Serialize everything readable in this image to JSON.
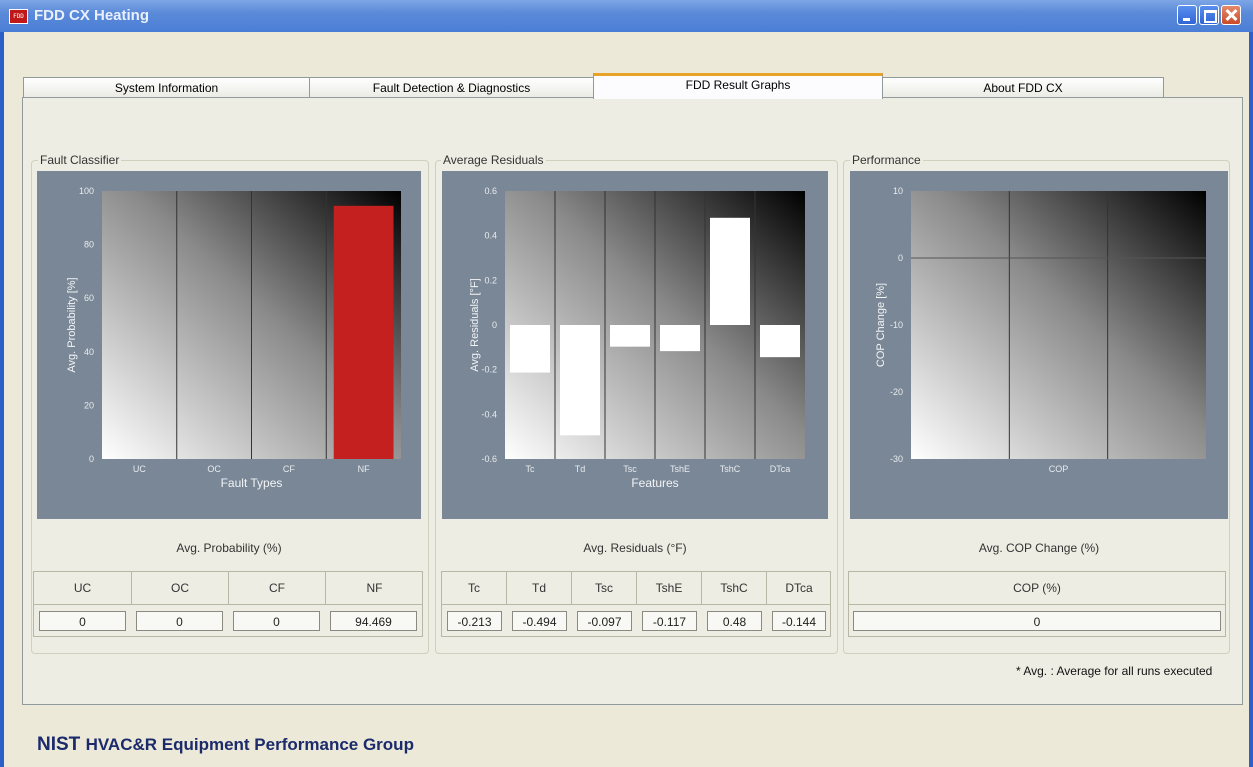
{
  "window": {
    "title": "FDD CX Heating",
    "icon": "FDD",
    "controls": [
      "minimize",
      "maximize",
      "close"
    ]
  },
  "tabs": [
    {
      "label": "System Information",
      "active": false
    },
    {
      "label": "Fault Detection & Diagnostics",
      "active": false
    },
    {
      "label": "FDD Result Graphs",
      "active": true
    },
    {
      "label": "About FDD CX",
      "active": false
    }
  ],
  "groups": {
    "fault_classifier": {
      "title": "Fault Classifier",
      "caption": "Avg. Probability (%)"
    },
    "average_residuals": {
      "title": "Average Residuals",
      "caption": "Avg. Residuals (°F)"
    },
    "performance": {
      "title": "Performance",
      "caption": "Avg. COP Change (%)"
    }
  },
  "chart_data": [
    {
      "type": "bar",
      "xlabel": "Fault Types",
      "ylabel": "Avg. Probability [%]",
      "categories": [
        "UC",
        "OC",
        "CF",
        "NF"
      ],
      "values": [
        0,
        0,
        0,
        94.469
      ],
      "ylim": [
        0,
        100
      ],
      "yticks": [
        "0",
        "20",
        "40",
        "60",
        "80",
        "100"
      ],
      "bar_color": "#c42020"
    },
    {
      "type": "bar",
      "xlabel": "Features",
      "ylabel": "Avg. Residuals [°F]",
      "categories": [
        "Tc",
        "Td",
        "Tsc",
        "TshE",
        "TshC",
        "DTca"
      ],
      "values": [
        -0.213,
        -0.494,
        -0.097,
        -0.117,
        0.48,
        -0.144
      ],
      "ylim": [
        -0.6,
        0.6
      ],
      "yticks": [
        "-0.6",
        "-0.4",
        "-0.2",
        "0",
        "0.2",
        "0.4",
        "0.6"
      ],
      "bar_color": "#ffffff"
    },
    {
      "type": "bar",
      "xlabel": "",
      "ylabel": "COP Change [%]",
      "categories": [
        "COP"
      ],
      "values": [
        0
      ],
      "ylim": [
        -30,
        10
      ],
      "yticks": [
        "-30",
        "-20",
        "-10",
        "0",
        "10"
      ],
      "bar_color": "#ffffff"
    }
  ],
  "tables": {
    "fault_classifier": {
      "headers": [
        "UC",
        "OC",
        "CF",
        "NF"
      ],
      "values": [
        "0",
        "0",
        "0",
        "94.469"
      ]
    },
    "average_residuals": {
      "headers": [
        "Tc",
        "Td",
        "Tsc",
        "TshE",
        "TshC",
        "DTca"
      ],
      "values": [
        "-0.213",
        "-0.494",
        "-0.097",
        "-0.117",
        "0.48",
        "-0.144"
      ]
    },
    "performance": {
      "headers": [
        "COP (%)"
      ],
      "values": [
        "0"
      ]
    }
  },
  "footnote": "* Avg. : Average for all runs executed",
  "brand": {
    "bold": "NIST",
    "rest": "HVAC&R Equipment Performance Group"
  }
}
